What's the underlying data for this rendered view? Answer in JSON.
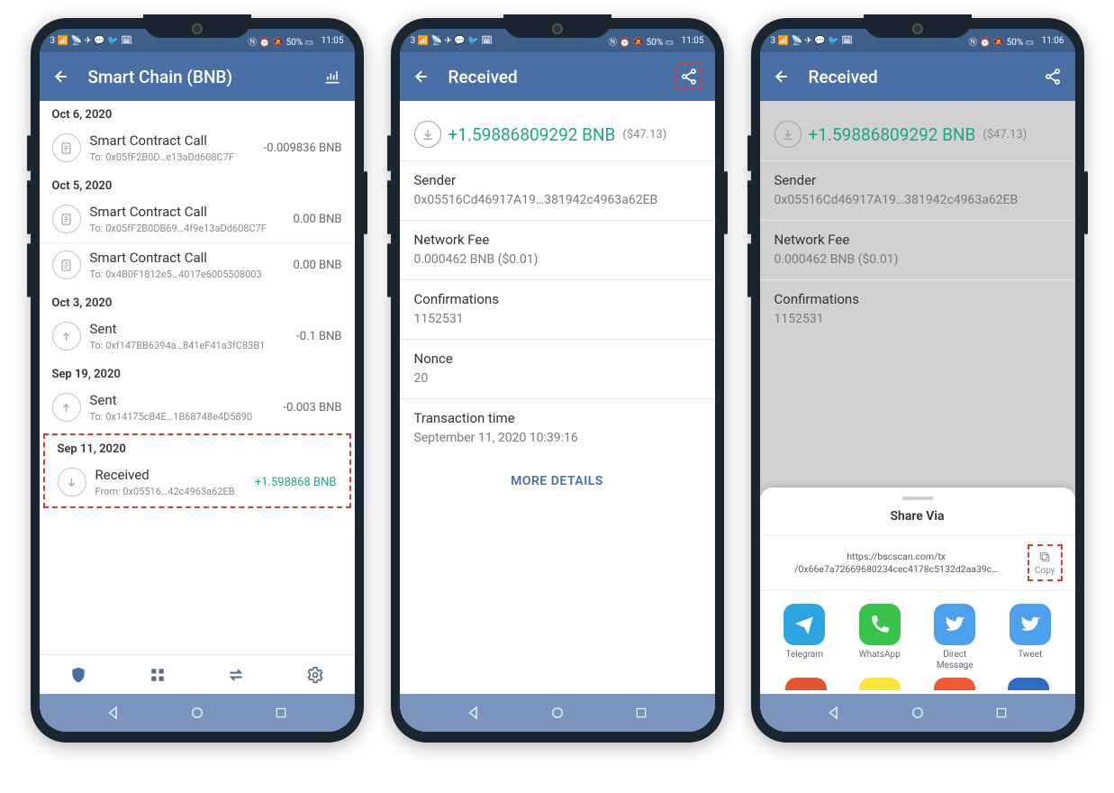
{
  "status": {
    "left_icons": "3 📶 📡 ✈ 💬 🐦 🗓",
    "right_time_1": "11:05",
    "right_time_2": "11:05",
    "right_time_3": "11:06",
    "right_icons": "Ⓝ ⏰ 🔕 50% ▭"
  },
  "screen1": {
    "title": "Smart Chain (BNB)",
    "groups": [
      {
        "date": "Oct 6, 2020",
        "txs": [
          {
            "kind": "contract",
            "title": "Smart Contract Call",
            "sub": "To: 0x05fF2B0D…e13aDd608C7F",
            "amt": "-0.009836 BNB"
          }
        ]
      },
      {
        "date": "Oct 5, 2020",
        "txs": [
          {
            "kind": "contract",
            "title": "Smart Contract Call",
            "sub": "To: 0x05fF2B0DB69…4f9e13aDd608C7F",
            "amt": "0.00 BNB"
          },
          {
            "kind": "contract",
            "title": "Smart Contract Call",
            "sub": "To: 0x4B0F1812e5…4017e6005508003",
            "amt": "0.00 BNB"
          }
        ]
      },
      {
        "date": "Oct 3, 2020",
        "txs": [
          {
            "kind": "sent",
            "title": "Sent",
            "sub": "To: 0xf147BB6394a…841eF41a3fC83B1",
            "amt": "-0.1 BNB"
          }
        ]
      },
      {
        "date": "Sep 19, 2020",
        "txs": [
          {
            "kind": "sent",
            "title": "Sent",
            "sub": "To: 0x14175cB4E…1B68748e4D5890",
            "amt": "-0.003 BNB"
          }
        ]
      },
      {
        "date": "Sep 11, 2020",
        "highlight": true,
        "txs": [
          {
            "kind": "recv",
            "title": "Received",
            "sub": "From: 0x05516…42c4963a62EB",
            "amt": "+1.598868 BNB",
            "pos": true
          }
        ]
      }
    ]
  },
  "screen2": {
    "title": "Received",
    "amount": "+1.59886809292 BNB",
    "amount_usd": "($47.13)",
    "details": [
      {
        "label": "Sender",
        "value": "0x05516Cd46917A19…381942c4963a62EB"
      },
      {
        "label": "Network Fee",
        "value": "0.000462 BNB ($0.01)"
      },
      {
        "label": "Confirmations",
        "value": "1152531"
      },
      {
        "label": "Nonce",
        "value": "20"
      },
      {
        "label": "Transaction time",
        "value": "September 11, 2020 10:39:16"
      }
    ],
    "more": "MORE DETAILS"
  },
  "screen3": {
    "title": "Received",
    "amount": "+1.59886809292 BNB",
    "amount_usd": "($47.13)",
    "details": [
      {
        "label": "Sender",
        "value": "0x05516Cd46917A19…381942c4963a62EB"
      },
      {
        "label": "Network Fee",
        "value": "0.000462 BNB ($0.01)"
      },
      {
        "label": "Confirmations",
        "value": "1152531"
      }
    ],
    "sheet": {
      "title": "Share Via",
      "url": "https://bscscan.com/tx\n/0x66e7a72669680234cec4178c5132d2aa39c…",
      "copy": "Copy",
      "apps": [
        {
          "name": "Telegram",
          "bg": "#2da5e1",
          "glyph": "plane"
        },
        {
          "name": "WhatsApp",
          "bg": "#3ac34b",
          "glyph": "phone"
        },
        {
          "name": "Direct Message",
          "bg": "#4da0eb",
          "glyph": "bird"
        },
        {
          "name": "Tweet",
          "bg": "#4da0eb",
          "glyph": "bird"
        }
      ],
      "partial": [
        {
          "bg": "#e0572e"
        },
        {
          "bg": "#fbe53b"
        },
        {
          "bg": "#ef5a34"
        },
        {
          "bg": "#2f6cc4"
        }
      ]
    }
  }
}
